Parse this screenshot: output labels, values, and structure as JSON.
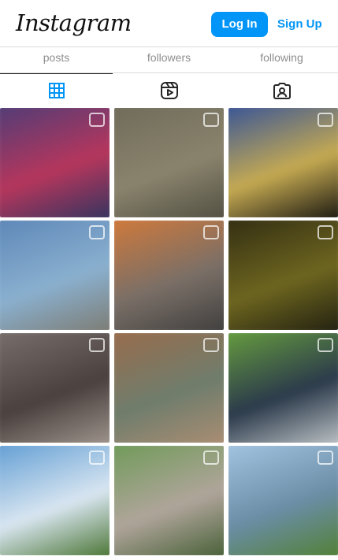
{
  "header": {
    "logo": "Instagram",
    "login_label": "Log In",
    "signup_label": "Sign Up"
  },
  "stats": [
    {
      "label": "posts"
    },
    {
      "label": "followers"
    },
    {
      "label": "following"
    }
  ],
  "tabs": [
    {
      "name": "posts-grid-icon",
      "active": true
    },
    {
      "name": "reels-icon",
      "active": false
    },
    {
      "name": "tagged-icon",
      "active": false
    }
  ],
  "accent_color": "#0095f6",
  "grid": {
    "posts": [
      {
        "colors": [
          "#4a3d78",
          "#b6365c",
          "#28345f"
        ]
      },
      {
        "colors": [
          "#6e6a59",
          "#8a836d",
          "#4c4b3e"
        ]
      },
      {
        "colors": [
          "#2f4f9b",
          "#c5aa52",
          "#0b0b0b"
        ]
      },
      {
        "colors": [
          "#5a84b6",
          "#8ab0cf",
          "#7b776b"
        ]
      },
      {
        "colors": [
          "#d67a38",
          "#7a6f67",
          "#3a3a3a"
        ]
      },
      {
        "colors": [
          "#2f2a12",
          "#6d651f",
          "#1b1a0f"
        ]
      },
      {
        "colors": [
          "#7b716f",
          "#4a403e",
          "#a69c94"
        ]
      },
      {
        "colors": [
          "#9b6b4b",
          "#6f7d6c",
          "#b08f74"
        ]
      },
      {
        "colors": [
          "#6aa33e",
          "#2b3a4b",
          "#c9ced0"
        ]
      },
      {
        "colors": [
          "#5b9ad2",
          "#d9e6f1",
          "#3d6a22"
        ]
      },
      {
        "colors": [
          "#6b9a54",
          "#b0a59b",
          "#3e5a2e"
        ]
      },
      {
        "colors": [
          "#a7c8e6",
          "#6b8da5",
          "#4f7f2b"
        ]
      }
    ]
  }
}
